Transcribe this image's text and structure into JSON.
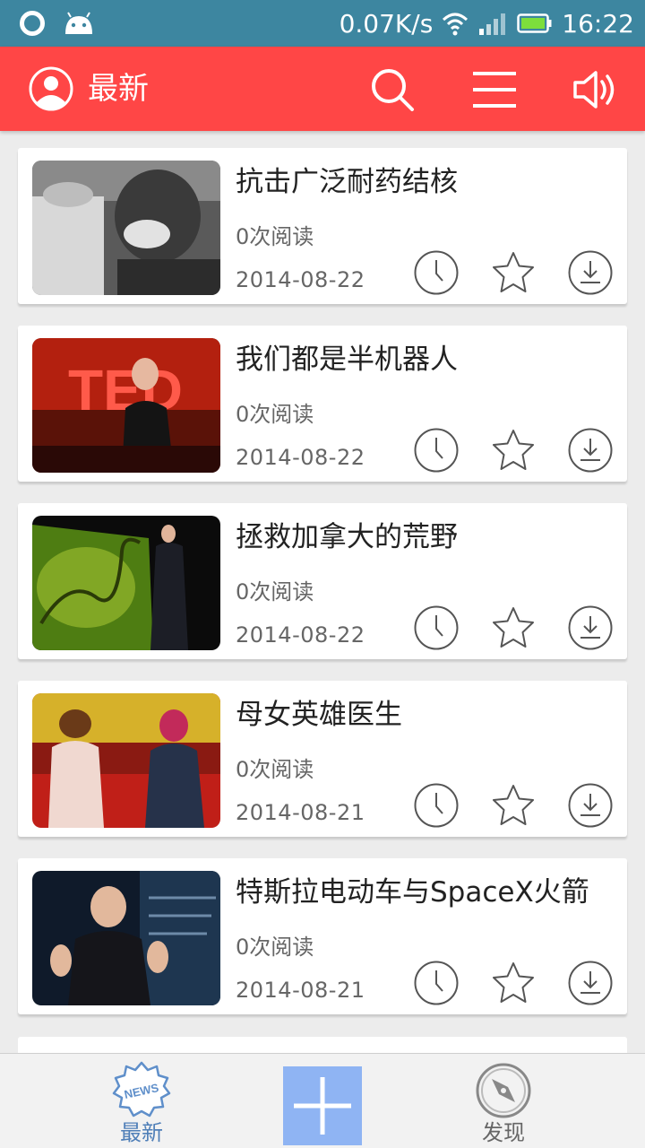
{
  "status_bar": {
    "speed": "0.07K/s",
    "time": "16:22"
  },
  "app_bar": {
    "title": "最新",
    "icons": [
      "user-avatar-icon",
      "search-icon",
      "menu-icon",
      "speaker-icon"
    ]
  },
  "articles": [
    {
      "title": "抗击广泛耐药结核",
      "reads": "0次阅读",
      "date": "2014-08-22"
    },
    {
      "title": "我们都是半机器人",
      "reads": "0次阅读",
      "date": "2014-08-22"
    },
    {
      "title": "拯救加拿大的荒野",
      "reads": "0次阅读",
      "date": "2014-08-22"
    },
    {
      "title": "母女英雄医生",
      "reads": "0次阅读",
      "date": "2014-08-21"
    },
    {
      "title": "特斯拉电动车与SpaceX火箭",
      "reads": "0次阅读",
      "date": "2014-08-21"
    }
  ],
  "bottom_nav": {
    "latest_label": "最新",
    "latest_badge": "NEWS",
    "discover_label": "发现"
  },
  "colors": {
    "accent": "#ff4646",
    "status_bar": "#3d86a0",
    "add_button": "#8fb4f3",
    "active_tab": "#4f7fb8"
  }
}
